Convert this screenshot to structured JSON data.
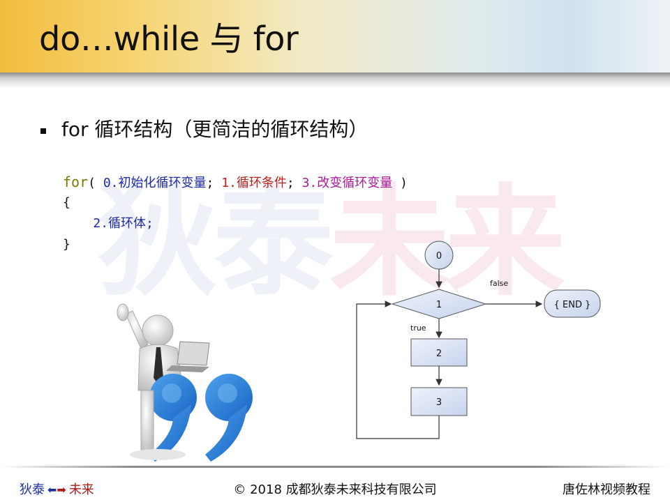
{
  "header": {
    "title": "do…while 与 for"
  },
  "watermark": {
    "part1": "狄泰",
    "part2": "未来"
  },
  "bullet": {
    "text": "for 循环结构（更简洁的循环结构）"
  },
  "code": {
    "keyword": "for",
    "open_paren": "( ",
    "init": "0.初始化循环变量",
    "sep1": "; ",
    "cond": "1.循环条件",
    "sep2": "; ",
    "update": "3.改变循环变量",
    "close_paren": " )",
    "brace_open": "{",
    "body": "2.循环体;",
    "brace_close": "}"
  },
  "flowchart": {
    "node0": "0",
    "node1": "1",
    "node2": "2",
    "node3": "3",
    "end": "{ END }",
    "false_label": "false",
    "true_label": "true"
  },
  "footer": {
    "left_part1": "狄泰",
    "left_part2": "未来",
    "center": "© 2018 成都狄泰未来科技有限公司",
    "right": "唐佐林视频教程"
  },
  "colors": {
    "code_keyword": "#7a7a00",
    "code_init": "#1b2aa8",
    "code_condition": "#c0201b",
    "code_update": "#b0189a",
    "flow_node_fill": "#d6e0f2",
    "flow_node_stroke": "#6b7fa8"
  },
  "icons": [
    "arrow-left-icon",
    "arrow-right-icon",
    "quote-icon"
  ]
}
